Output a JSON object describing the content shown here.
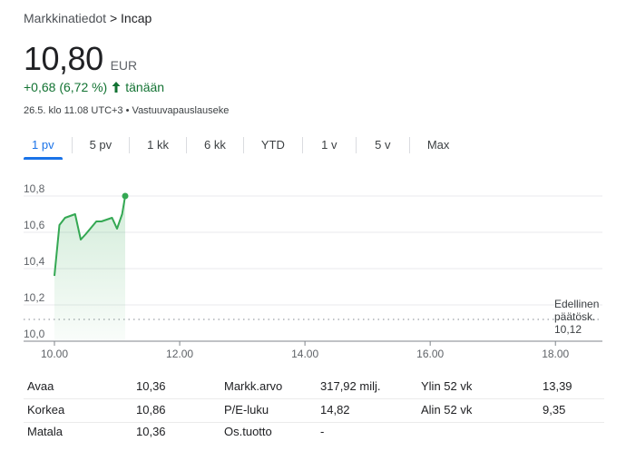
{
  "breadcrumb": {
    "parent": "Markkinatiedot",
    "separator": ">",
    "current": "Incap"
  },
  "quote": {
    "price": "10,80",
    "currency": "EUR",
    "change": "+0,68 (6,72 %)",
    "change_suffix": "tänään",
    "change_color": "#137333",
    "timestamp": "26.5. klo 11.08 UTC+3",
    "bullet": "•",
    "disclaimer": "Vastuuvapauslauseke"
  },
  "tabs": [
    {
      "label": "1 pv",
      "active": true
    },
    {
      "label": "5 pv",
      "active": false
    },
    {
      "label": "1 kk",
      "active": false
    },
    {
      "label": "6 kk",
      "active": false
    },
    {
      "label": "YTD",
      "active": false
    },
    {
      "label": "1 v",
      "active": false
    },
    {
      "label": "5 v",
      "active": false
    },
    {
      "label": "Max",
      "active": false
    }
  ],
  "chart_data": {
    "type": "area",
    "x_ticks": [
      "10.00",
      "12.00",
      "14.00",
      "16.00",
      "18.00"
    ],
    "x_range_hours": [
      10,
      18.75
    ],
    "y_ticks": [
      "10,8",
      "10,6",
      "10,4",
      "10,2",
      "10,0"
    ],
    "ylim": [
      10.0,
      10.8
    ],
    "grid": true,
    "line_color": "#34a853",
    "series": [
      {
        "x": [
          10.0,
          10.08,
          10.17,
          10.33,
          10.42,
          10.5,
          10.67,
          10.75,
          10.92,
          11.0,
          11.08,
          11.13
        ],
        "values": [
          10.36,
          10.64,
          10.68,
          10.7,
          10.56,
          10.59,
          10.66,
          10.66,
          10.68,
          10.62,
          10.7,
          10.8
        ]
      }
    ],
    "reference": {
      "label_line1": "Edellinen",
      "label_line2": "päätösk.",
      "value_label": "10,12",
      "value": 10.12
    }
  },
  "stats": {
    "col1": [
      {
        "label": "Avaa",
        "value": "10,36"
      },
      {
        "label": "Korkea",
        "value": "10,86"
      },
      {
        "label": "Matala",
        "value": "10,36"
      }
    ],
    "col2": [
      {
        "label": "Markk.arvo",
        "value": "317,92 milj."
      },
      {
        "label": "P/E-luku",
        "value": "14,82"
      },
      {
        "label": "Os.tuotto",
        "value": "-"
      }
    ],
    "col3": [
      {
        "label": "Ylin 52 vk",
        "value": "13,39"
      },
      {
        "label": "Alin 52 vk",
        "value": "9,35"
      }
    ]
  }
}
